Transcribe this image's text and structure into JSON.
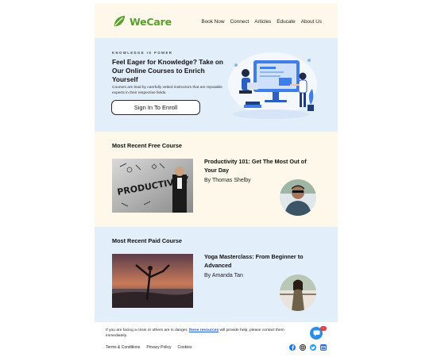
{
  "brand": {
    "name": "WeCare",
    "color": "#5aa02c"
  },
  "nav": {
    "items": [
      "Book Now",
      "Connect",
      "Articles",
      "Educate",
      "About Us"
    ]
  },
  "hero": {
    "kicker": "KNOWLEDGE IS POWER",
    "title": "Feel Eager for Knowledge? Take on Our Online Courses to Enrich Yourself",
    "subtitle": "Courses are lead by carefully vetted instructors that are reputable experts in their respective fields.",
    "button": "Sign In To Enroll"
  },
  "free_course": {
    "section_title": "Most Recent Free Course",
    "title": "Productivity 101: Get The Most Out of Your Day",
    "author": "By Thomas Shelby",
    "thumb_text": "PRODUCTIVITY"
  },
  "paid_course": {
    "section_title": "Most Recent Paid Course",
    "title": "Yoga Masterclass: From Beginner to Advanced",
    "author": "By Amanda Tan"
  },
  "footer": {
    "text_before": "If you are facing a crisis or others are in danger, ",
    "link": "these resources",
    "text_after": " will provide help, please contact them immediately.",
    "links": [
      "Terms & Conditions",
      "Privacy Policy",
      "Cookies"
    ],
    "socials": [
      "facebook-icon",
      "instagram-icon",
      "twitter-icon",
      "email-icon"
    ]
  },
  "colors": {
    "hero_bg": "#e3eefb",
    "cream_bg": "#fdf8ea",
    "accent_blue": "#2b8ee6"
  }
}
